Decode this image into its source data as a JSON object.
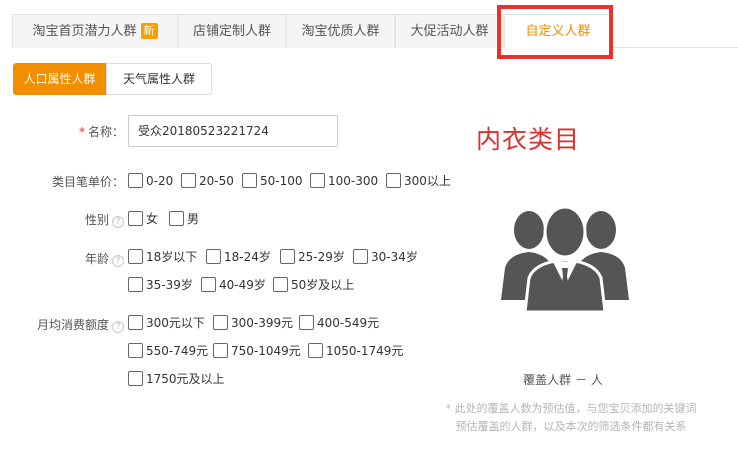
{
  "top_tabs": [
    {
      "label": "淘宝首页潜力人群",
      "badge": "新"
    },
    {
      "label": "店铺定制人群"
    },
    {
      "label": "淘宝优质人群"
    },
    {
      "label": "大促活动人群"
    },
    {
      "label": "自定义人群"
    }
  ],
  "sub_tabs": [
    "人口属性人群",
    "天气属性人群"
  ],
  "form": {
    "name": {
      "required_mark": "*",
      "label": "名称：",
      "value": "受众20180523221724"
    },
    "price": {
      "label": "类目笔单价：",
      "options": [
        "0-20",
        "20-50",
        "50-100",
        "100-300",
        "300以上"
      ]
    },
    "gender": {
      "label": "性别",
      "options": [
        "女",
        "男"
      ]
    },
    "age": {
      "label": "年龄",
      "options": [
        "18岁以下",
        "18-24岁",
        "25-29岁",
        "30-34岁",
        "35-39岁",
        "40-49岁",
        "50岁及以上"
      ]
    },
    "spend": {
      "label": "月均消费额度",
      "options": [
        "300元以下",
        "300-399元",
        "400-549元",
        "550-749元",
        "750-1049元",
        "1050-1749元",
        "1750元及以上"
      ]
    },
    "help_glyph": "?"
  },
  "annotation": "内衣类目",
  "panel": {
    "icon": "people-group-icon",
    "coverage_label": "覆盖人群",
    "coverage_value": "－ 人",
    "note": "* 此处的覆盖人数为预估值，与您宝贝添加的关键词预估覆盖的人群，以及本次的筛选条件都有关系"
  },
  "colors": {
    "accent": "#f18f00",
    "highlight": "#e8322b",
    "annotation": "#d9322d"
  }
}
